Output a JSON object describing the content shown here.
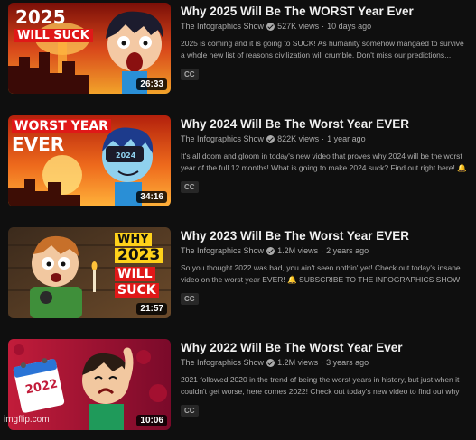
{
  "videos": [
    {
      "title": "Why 2025 Will Be The WORST Year Ever",
      "channel": "The Infographics Show",
      "views": "527K views",
      "age": "10 days ago",
      "description": "2025 is coming and it is going to SUCK! As humanity somehow mangaed to survive a whole new list of reasons civilization will crumble. Don't miss our predictions...",
      "duration": "26:33",
      "badge": "CC",
      "thumb_text": [
        "2025",
        "WILL SUCK"
      ]
    },
    {
      "title": "Why 2024 Will Be The Worst Year EVER",
      "channel": "The Infographics Show",
      "views": "822K views",
      "age": "1 year ago",
      "description": "It's all doom and gloom in today's new video that proves why 2024 will be the worst year of the full 12 months! What is going to make 2024 suck? Find out right here! 🔔 ...",
      "duration": "34:16",
      "badge": "CC",
      "thumb_text": [
        "WORST YEAR",
        "EVER",
        "2024"
      ]
    },
    {
      "title": "Why 2023 Will Be The Worst Year EVER",
      "channel": "The Infographics Show",
      "views": "1.2M views",
      "age": "2 years ago",
      "description": "So you thought 2022 was bad, you ain't seen nothin' yet! Check out today's insane video on the worst year EVER! 🔔 SUBSCRIBE TO THE INFOGRAPHICS SHOW ► https://w...",
      "duration": "21:57",
      "badge": "CC",
      "thumb_text": [
        "WHY",
        "2023",
        "WILL",
        "SUCK"
      ]
    },
    {
      "title": "Why 2022 Will Be The Worst Year Ever",
      "channel": "The Infographics Show",
      "views": "1.2M views",
      "age": "3 years ago",
      "description": "2021 followed 2020 in the trend of being the worst years in history, but just when it couldn't get worse, here comes 2022! Check out today's new video to find out why next year...",
      "duration": "10:06",
      "badge": "CC",
      "thumb_text": [
        "2022"
      ]
    }
  ],
  "watermark": "imgflip.com",
  "colors": {
    "background": "#0f0f0f",
    "title": "#f1f1f1",
    "meta": "#aaaaaa",
    "badge_bg": "#272727"
  }
}
